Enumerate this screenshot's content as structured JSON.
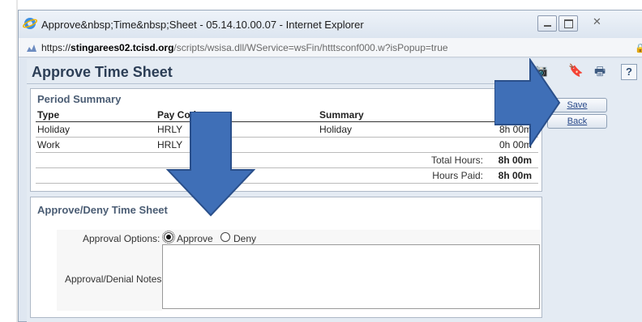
{
  "window": {
    "title": "Approve&nbsp;Time&nbsp;Sheet - 05.14.10.00.07 - Internet Explorer",
    "url_scheme": "https://",
    "url_domain": "stingarees02.tcisd.org",
    "url_path": "/scripts/wsisa.dll/WService=wsFin/htttsconf000.w?isPopup=true"
  },
  "page": {
    "title": "Approve Time Sheet"
  },
  "summary": {
    "title": "Period Summary",
    "headers": [
      "Type",
      "Pay Code",
      "Summary"
    ],
    "rows": [
      {
        "type": "Holiday",
        "pay_code": "HRLY",
        "summary": "Holiday",
        "hours": "8h 00m"
      },
      {
        "type": "Work",
        "pay_code": "HRLY",
        "summary": "",
        "hours": "0h 00m"
      }
    ],
    "total_hours_label": "Total Hours:",
    "total_hours": "8h 00m",
    "hours_paid_label": "Hours Paid:",
    "hours_paid": "8h 00m"
  },
  "actions": {
    "save": "Save",
    "back": "Back"
  },
  "approve": {
    "title": "Approve/Deny Time Sheet",
    "options_label": "Approval Options:",
    "approve_label": "Approve",
    "deny_label": "Deny",
    "selected": "Approve",
    "notes_label": "Approval/Denial Notes:",
    "notes_value": ""
  },
  "toolbar": {
    "help": "?"
  },
  "colors": {
    "arrow": "#3f6fb7",
    "title": "#2c3e56"
  }
}
